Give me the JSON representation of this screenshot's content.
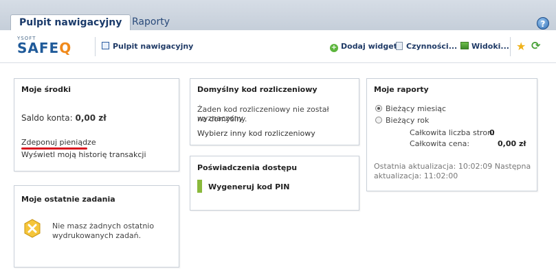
{
  "tabs": [
    {
      "label": "Pulpit nawigacyjny",
      "active": true
    },
    {
      "label": "Raporty",
      "active": false
    }
  ],
  "help_label": "?",
  "logo": {
    "small": "YSOFT",
    "big_main": "SAFE",
    "big_accent": "Q"
  },
  "toolbar": {
    "dashboard_label": "Pulpit nawigacyjny",
    "add_widget": "Dodaj widget",
    "actions": "Czynności...",
    "views": "Widoki..."
  },
  "panels": {
    "srodki": {
      "title": "Moje środki",
      "balance_label": "Saldo konta:",
      "balance_value": "0,00 zł",
      "deposit_link": "Zdeponuj pieniądze",
      "history_link": "Wyświetl moją historię transakcji"
    },
    "zadania": {
      "title": "Moje ostatnie zadania",
      "empty_line1": "Nie masz żadnych ostatnio",
      "empty_line2": "wydrukowanych zadań."
    },
    "kod": {
      "title": "Domyślny kod rozliczeniowy",
      "line1": "Żaden kod rozliczeniowy nie został wyznaczony",
      "line2": "na domyślny.",
      "choose_link": "Wybierz inny kod rozliczeniowy"
    },
    "poswiadczenia": {
      "title": "Poświadczenia dostępu",
      "pin_button": "Wygeneruj kod PIN"
    },
    "raporty": {
      "title": "Moje raporty",
      "option_month": "Bieżący miesiąc",
      "option_year": "Bieżący rok",
      "selected": "Bieżący miesiąc",
      "pages_label": "Całkowita liczba stron:",
      "pages_value": "0",
      "price_label": "Całkowita cena:",
      "price_value": "0,00 zł",
      "updated_line1": "Ostatnia aktualizacja: 10:02:09  Następna",
      "updated_line2": "aktualizacja: 11:02:00"
    }
  },
  "colors": {
    "accent": "#1f5a99",
    "logo_accent": "#f08a1c",
    "underline_red": "#d8141e",
    "pin_green": "#8ab93c"
  }
}
